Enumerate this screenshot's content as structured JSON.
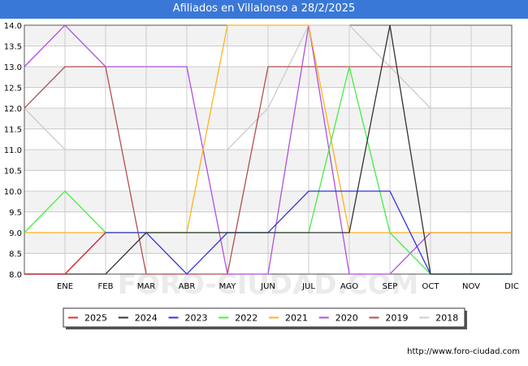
{
  "header": {
    "title": "Afiliados en Villalonso a 28/2/2025"
  },
  "footer": {
    "url": "http://www.foro-ciudad.com"
  },
  "watermark": "FORO-CIUDAD.COM",
  "colors": {
    "title_bg": "#3a78d8",
    "band": "#f2f2f2",
    "grid": "#cccccc"
  },
  "chart_data": {
    "type": "line",
    "title": "Afiliados en Villalonso a 28/2/2025",
    "categories": [
      "",
      "ENE",
      "FEB",
      "MAR",
      "ABR",
      "MAY",
      "JUN",
      "JUL",
      "AGO",
      "SEP",
      "OCT",
      "NOV",
      "DIC"
    ],
    "ylim": [
      8.0,
      14.0
    ],
    "yticks": [
      8.0,
      8.5,
      9.0,
      9.5,
      10.0,
      10.5,
      11.0,
      11.5,
      12.0,
      12.5,
      13.0,
      13.5,
      14.0
    ],
    "grid": true,
    "legend_position": "bottom",
    "series": [
      {
        "name": "2018",
        "color": "#cccccc",
        "values": [
          12,
          11,
          11,
          11,
          11,
          11,
          12,
          14,
          14,
          13,
          12,
          12,
          12
        ]
      },
      {
        "name": "2019",
        "color": "#b05050",
        "values": [
          12,
          13,
          13,
          8,
          8,
          8,
          13,
          13,
          13,
          13,
          13,
          13,
          13
        ]
      },
      {
        "name": "2020",
        "color": "#b050e0",
        "values": [
          13,
          14,
          13,
          13,
          13,
          8,
          8,
          14,
          8,
          8,
          9,
          9,
          9
        ]
      },
      {
        "name": "2021",
        "color": "#ffb31a",
        "values": [
          9,
          9,
          9,
          9,
          9,
          14,
          14,
          14,
          9,
          9,
          9,
          9,
          9
        ]
      },
      {
        "name": "2022",
        "color": "#44ee44",
        "values": [
          9,
          10,
          9,
          9,
          9,
          9,
          9,
          9,
          13,
          9,
          8,
          8,
          8
        ]
      },
      {
        "name": "2023",
        "color": "#3333dd",
        "values": [
          8,
          8,
          9,
          9,
          8,
          9,
          9,
          10,
          10,
          10,
          8,
          8,
          8
        ]
      },
      {
        "name": "2024",
        "color": "#333333",
        "values": [
          8,
          8,
          8,
          9,
          9,
          9,
          9,
          9,
          9,
          14,
          8,
          8,
          8
        ]
      },
      {
        "name": "2025",
        "color": "#e03030",
        "values": [
          8,
          8,
          9
        ]
      }
    ],
    "legend": [
      "2025",
      "2024",
      "2023",
      "2022",
      "2021",
      "2020",
      "2019",
      "2018"
    ]
  }
}
